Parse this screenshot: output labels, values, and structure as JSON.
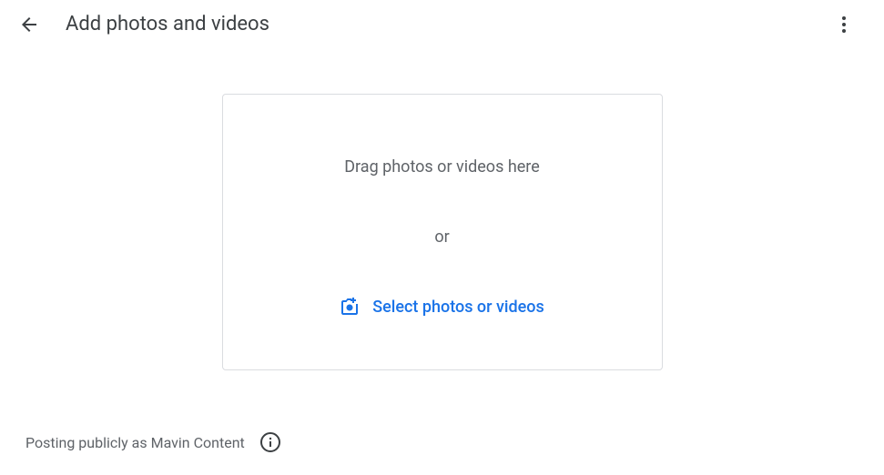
{
  "header": {
    "title": "Add photos and videos"
  },
  "dropzone": {
    "drag_text": "Drag photos or videos here",
    "or_text": "or",
    "select_text": "Select photos or videos"
  },
  "footer": {
    "posting_text": "Posting publicly as Mavin Content"
  }
}
